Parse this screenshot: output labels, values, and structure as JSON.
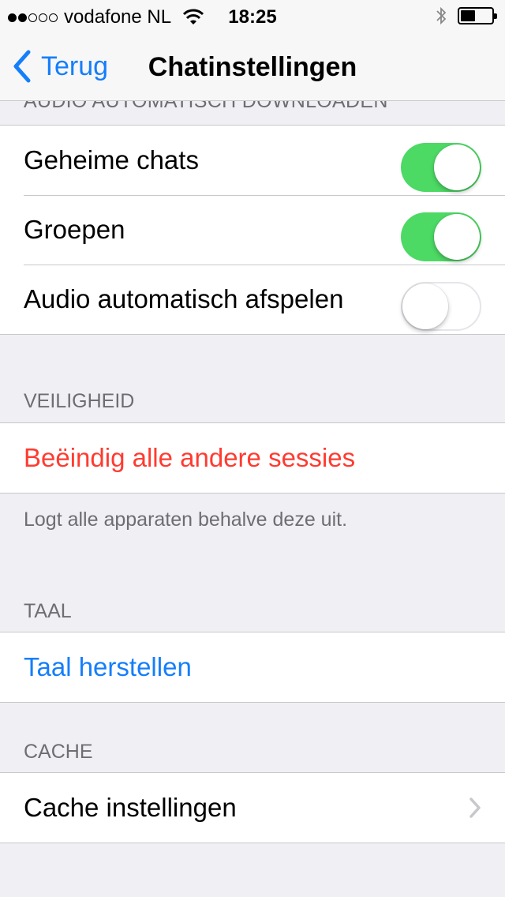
{
  "status_bar": {
    "carrier": "vodafone NL",
    "time": "18:25",
    "signal_filled": 2,
    "signal_total": 5
  },
  "nav": {
    "back_label": "Terug",
    "title": "Chatinstellingen"
  },
  "audio_section": {
    "header": "AUDIO AUTOMATISCH DOWNLOADEN",
    "rows": [
      {
        "label": "Geheime chats",
        "toggle": "on"
      },
      {
        "label": "Groepen",
        "toggle": "on"
      },
      {
        "label": "Audio automatisch afspelen",
        "toggle": "off"
      }
    ]
  },
  "security_section": {
    "header": "VEILIGHEID",
    "action": "Beëindig alle andere sessies",
    "footer": "Logt alle apparaten behalve deze uit."
  },
  "language_section": {
    "header": "TAAL",
    "action": "Taal herstellen"
  },
  "cache_section": {
    "header": "CACHE",
    "row": "Cache instellingen"
  },
  "colors": {
    "accent": "#157efb",
    "destructive": "#ff3b30",
    "toggle_on": "#4cd964",
    "background": "#efeff4"
  }
}
